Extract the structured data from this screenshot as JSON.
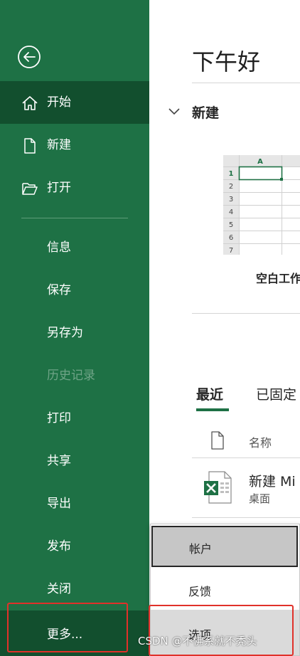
{
  "sidebar": {
    "items": [
      {
        "label": "开始",
        "icon": "home-icon"
      },
      {
        "label": "新建",
        "icon": "new-document-icon"
      },
      {
        "label": "打开",
        "icon": "open-folder-icon"
      },
      {
        "label": "信息"
      },
      {
        "label": "保存"
      },
      {
        "label": "另存为"
      },
      {
        "label": "历史记录"
      },
      {
        "label": "打印"
      },
      {
        "label": "共享"
      },
      {
        "label": "导出"
      },
      {
        "label": "发布"
      },
      {
        "label": "关闭"
      }
    ],
    "more_label": "更多..."
  },
  "main": {
    "greeting": "下午好",
    "new_section_title": "新建",
    "blank_workbook_label": "空白工作簿",
    "thumb_col_header": "A",
    "thumb_rows": [
      "1",
      "2",
      "3",
      "4",
      "5",
      "6",
      "7"
    ],
    "tabs": [
      {
        "label": "最近"
      },
      {
        "label": "已固定"
      }
    ],
    "list_header_name": "名称",
    "recent_file": {
      "name": "新建 Mi",
      "location": "桌面"
    }
  },
  "menu": {
    "items": [
      {
        "label": "帐户"
      },
      {
        "label": "反馈"
      },
      {
        "label": "选项"
      }
    ]
  },
  "watermark": "CSDN @不佛系就不秃头",
  "colors": {
    "sidebar": "#1e7145",
    "sidebar_active": "#124f2e",
    "highlight": "#e0312a"
  }
}
